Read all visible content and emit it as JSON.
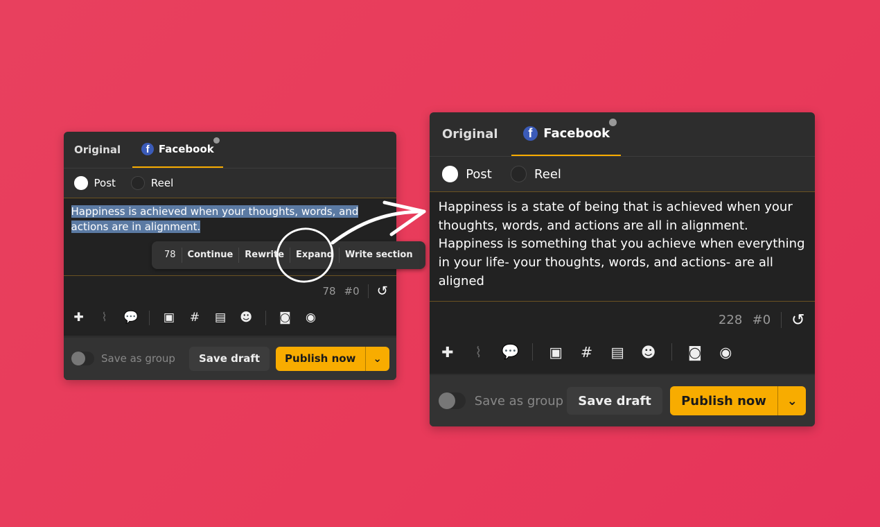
{
  "left_panel": {
    "tabs": [
      {
        "label": "Original"
      },
      {
        "label": "Facebook",
        "icon": "facebook-icon"
      }
    ],
    "post_types": [
      {
        "label": "Post",
        "selected": true
      },
      {
        "label": "Reel",
        "selected": false
      }
    ],
    "text_line1": "Happiness is achieved when your thoughts, words, and",
    "text_line2": "actions are in alignment.",
    "ai_menu": {
      "count": "78",
      "items": [
        "Continue",
        "Rewrite",
        "Expand",
        "Write section"
      ]
    },
    "char_count": "78",
    "hashtag_count": "#0",
    "save_group": "Save as group",
    "save_draft": "Save draft",
    "publish": "Publish now"
  },
  "right_panel": {
    "tabs": [
      {
        "label": "Original"
      },
      {
        "label": "Facebook",
        "icon": "facebook-icon"
      }
    ],
    "post_types": [
      {
        "label": "Post",
        "selected": true
      },
      {
        "label": "Reel",
        "selected": false
      }
    ],
    "text": "Happiness is a state of being that is achieved when your thoughts, words, and actions are all in alignment. Happiness is something that you achieve when everything in your life- your thoughts, words, and actions- are all aligned",
    "char_count": "228",
    "hashtag_count": "#0",
    "save_group": "Save as group",
    "save_draft": "Save draft",
    "publish": "Publish now"
  },
  "toolbar_icons": [
    "plus-icon",
    "paperclip-icon",
    "comments-icon",
    "robot-icon",
    "hashtag-icon",
    "scroll-icon",
    "smiley-icon",
    "camera-icon",
    "eye-icon"
  ],
  "colors": {
    "background": "#e83c5c",
    "panel": "#2d2d2d",
    "accent": "#f8ac00",
    "selection": "#5b7aa3",
    "facebook": "#3b5bb8"
  }
}
